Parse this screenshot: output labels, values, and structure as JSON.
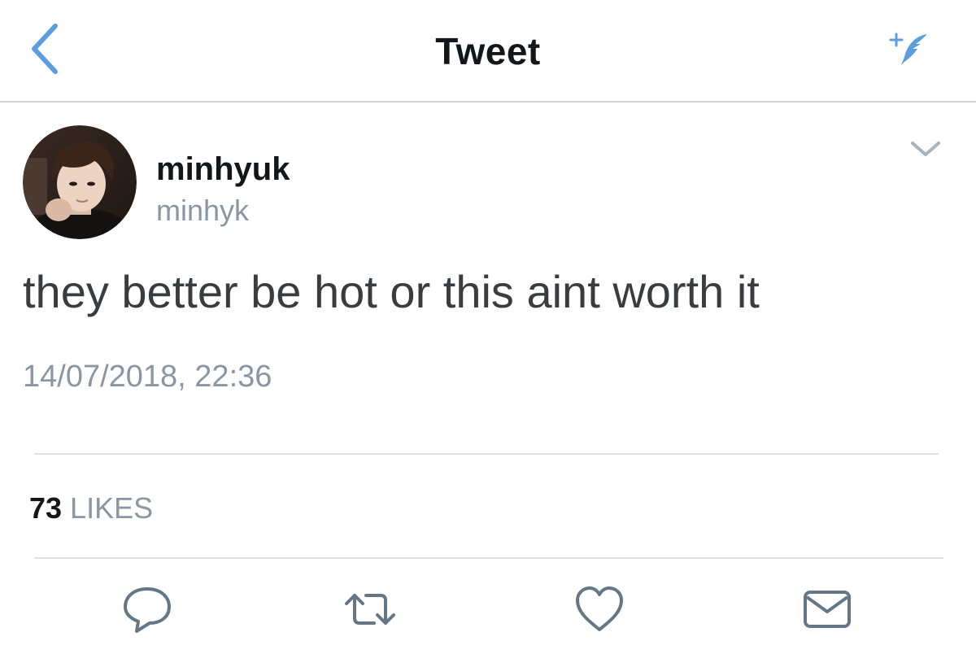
{
  "nav": {
    "title": "Tweet",
    "back_icon": "chevron-left-icon",
    "compose_icon": "compose-feather-icon",
    "accent_color": "#5b9ee0"
  },
  "tweet": {
    "display_name": "minhyuk",
    "screen_name": "minhyk",
    "text": "they better be hot or this aint worth it",
    "timestamp": "14/07/2018, 22:36",
    "likes_count": "73",
    "likes_label": "LIKES",
    "caret_icon": "chevron-down-icon"
  },
  "actions": [
    {
      "name": "reply",
      "icon": "reply-bubble-icon"
    },
    {
      "name": "retweet",
      "icon": "retweet-icon"
    },
    {
      "name": "like",
      "icon": "heart-icon"
    },
    {
      "name": "share",
      "icon": "envelope-icon"
    }
  ],
  "colors": {
    "text_primary": "#14171a",
    "text_secondary": "#8a96a3",
    "icon_gray": "#657786",
    "divider": "#dde0e3"
  }
}
